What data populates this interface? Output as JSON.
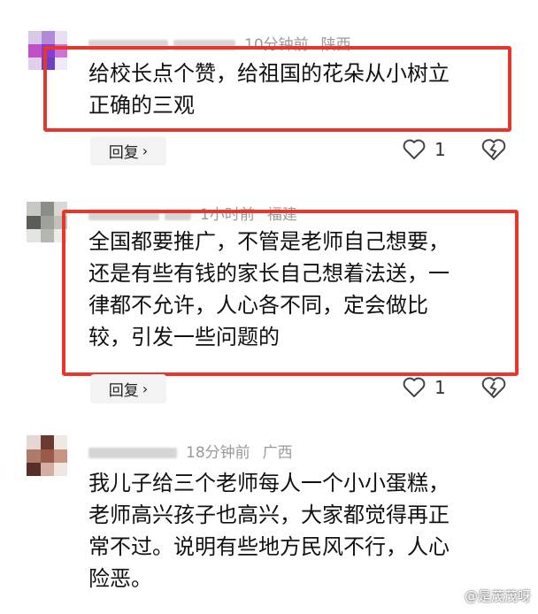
{
  "comments": [
    {
      "meta_time": "10分钟前",
      "meta_location": "陕西",
      "text_lines": [
        "给校长点个赞，给祖国的花朵从小树立",
        "正确的三观"
      ],
      "reply_label": "回复",
      "likes": "1"
    },
    {
      "meta_time": "1小时前",
      "meta_location": "福建",
      "text_lines": [
        "全国都要推广，不管是老师自己想要，",
        "还是有些有钱的家长自己想着法送，一",
        "律都不允许，人心各不同，定会做比",
        "较，引发一些问题的"
      ],
      "reply_label": "回复",
      "likes": "1"
    },
    {
      "meta_time": "18分钟前",
      "meta_location": "广西",
      "text_lines": [
        "我儿子给三个老师每人一个小小蛋糕，",
        "老师高兴孩子也高兴，大家都觉得再正",
        "常不过。说明有些地方民风不行，人心",
        "险恶。"
      ]
    }
  ],
  "watermark": "@是茂茂呀",
  "colors": {
    "highlight_border": "#e8362d",
    "meta_text": "#9a9a9a"
  },
  "icons": [
    "heart-icon",
    "heart-broken-icon",
    "chevron-right-icon"
  ]
}
